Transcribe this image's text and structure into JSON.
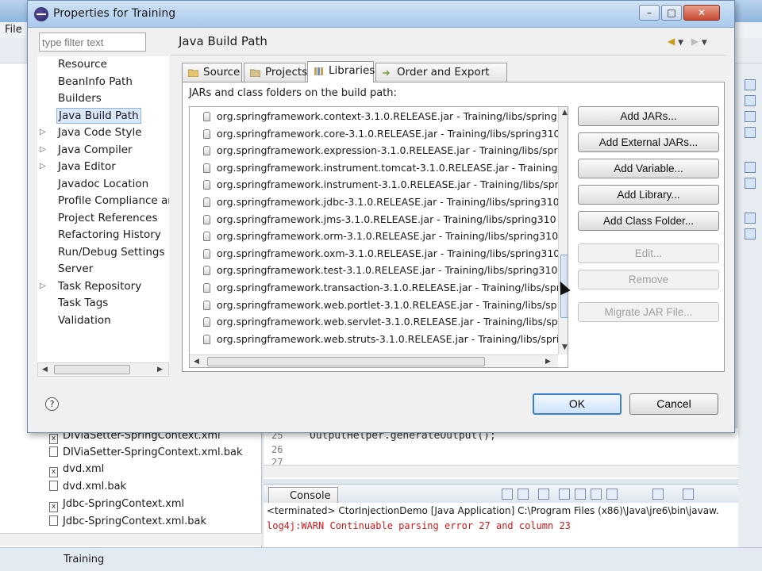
{
  "workbench": {
    "menu_first": "File",
    "status_text": "Training",
    "files": [
      "DIViaSetter-SpringContext.xml",
      "DIViaSetter-SpringContext.xml.bak",
      "dvd.xml",
      "dvd.xml.bak",
      "Jdbc-SpringContext.xml",
      "Jdbc-SpringContext.xml.bak"
    ],
    "editor_lines": [
      "25",
      "26",
      "27"
    ],
    "editor_code": "OutputHelper.generateOutput();",
    "console_tab": "Console",
    "console_line1": "<terminated> CtorInjectionDemo [Java Application] C:\\Program Files (x86)\\Java\\jre6\\bin\\javaw.",
    "console_line2": "log4j:WARN Continuable parsing error 27 and column 23"
  },
  "dialog": {
    "title": "Properties for Training",
    "filter_placeholder": "type filter text",
    "nav": [
      {
        "label": "Resource",
        "expandable": false,
        "selected": false
      },
      {
        "label": "BeanInfo Path",
        "expandable": false,
        "selected": false
      },
      {
        "label": "Builders",
        "expandable": false,
        "selected": false
      },
      {
        "label": "Java Build Path",
        "expandable": false,
        "selected": true
      },
      {
        "label": "Java Code Style",
        "expandable": true,
        "selected": false
      },
      {
        "label": "Java Compiler",
        "expandable": true,
        "selected": false
      },
      {
        "label": "Java Editor",
        "expandable": true,
        "selected": false
      },
      {
        "label": "Javadoc Location",
        "expandable": false,
        "selected": false
      },
      {
        "label": "Profile Compliance and",
        "expandable": false,
        "selected": false
      },
      {
        "label": "Project References",
        "expandable": false,
        "selected": false
      },
      {
        "label": "Refactoring History",
        "expandable": false,
        "selected": false
      },
      {
        "label": "Run/Debug Settings",
        "expandable": false,
        "selected": false
      },
      {
        "label": "Server",
        "expandable": false,
        "selected": false
      },
      {
        "label": "Task Repository",
        "expandable": true,
        "selected": false
      },
      {
        "label": "Task Tags",
        "expandable": false,
        "selected": false
      },
      {
        "label": "Validation",
        "expandable": false,
        "selected": false
      }
    ],
    "page_title": "Java Build Path",
    "tabs": [
      {
        "label": "Source",
        "active": false
      },
      {
        "label": "Projects",
        "active": false
      },
      {
        "label": "Libraries",
        "active": true
      },
      {
        "label": "Order and Export",
        "active": false
      }
    ],
    "panel_label": "JARs and class folders on the build path:",
    "jars": [
      "org.springframework.context-3.1.0.RELEASE.jar - Training/libs/spring",
      "org.springframework.core-3.1.0.RELEASE.jar - Training/libs/spring310",
      "org.springframework.expression-3.1.0.RELEASE.jar - Training/libs/spr",
      "org.springframework.instrument.tomcat-3.1.0.RELEASE.jar - Training/",
      "org.springframework.instrument-3.1.0.RELEASE.jar - Training/libs/spr",
      "org.springframework.jdbc-3.1.0.RELEASE.jar - Training/libs/spring310",
      "org.springframework.jms-3.1.0.RELEASE.jar - Training/libs/spring310",
      "org.springframework.orm-3.1.0.RELEASE.jar - Training/libs/spring310",
      "org.springframework.oxm-3.1.0.RELEASE.jar - Training/libs/spring310",
      "org.springframework.test-3.1.0.RELEASE.jar - Training/libs/spring310",
      "org.springframework.transaction-3.1.0.RELEASE.jar - Training/libs/spr",
      "org.springframework.web.portlet-3.1.0.RELEASE.jar - Training/libs/sp",
      "org.springframework.web.servlet-3.1.0.RELEASE.jar - Training/libs/sp",
      "org.springframework.web.struts-3.1.0.RELEASE.jar - Training/libs/spri"
    ],
    "buttons": {
      "add_jars": "Add JARs...",
      "add_external_jars": "Add External JARs...",
      "add_variable": "Add Variable...",
      "add_library": "Add Library...",
      "add_class_folder": "Add Class Folder...",
      "edit": "Edit...",
      "remove": "Remove",
      "migrate": "Migrate JAR File...",
      "ok": "OK",
      "cancel": "Cancel",
      "help": "?"
    }
  },
  "colors": {
    "selection": "#d9e9fb",
    "console_error": "#d01818",
    "default_button_border": "#3c7fd1"
  }
}
